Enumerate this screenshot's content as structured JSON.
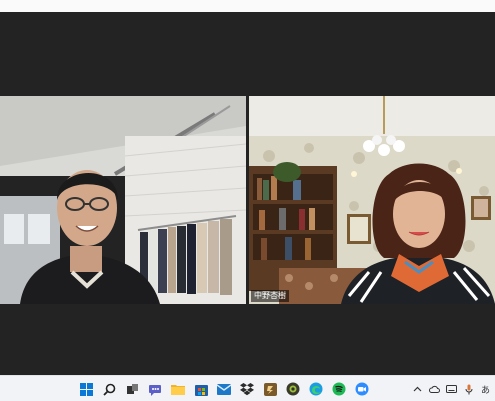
{
  "meeting": {
    "participants": [
      {
        "name": ""
      },
      {
        "name": "中野杏樹"
      }
    ]
  },
  "taskbar": {
    "apps": [
      {
        "icon": "windows-start-icon"
      },
      {
        "icon": "search-icon"
      },
      {
        "icon": "task-view-icon"
      },
      {
        "icon": "teams-chat-icon"
      },
      {
        "icon": "file-explorer-icon"
      },
      {
        "icon": "microsoft-store-icon"
      },
      {
        "icon": "mail-icon"
      },
      {
        "icon": "dropbox-icon"
      },
      {
        "icon": "app-icon"
      },
      {
        "icon": "chrome-style-icon"
      },
      {
        "icon": "edge-icon"
      },
      {
        "icon": "spotify-icon"
      },
      {
        "icon": "zoom-icon"
      }
    ],
    "tray": [
      {
        "icon": "chevron-up-icon"
      },
      {
        "icon": "cloud-icon"
      },
      {
        "icon": "keyboard-icon"
      },
      {
        "icon": "microphone-icon"
      },
      {
        "icon": "language-indicator-icon"
      }
    ],
    "language_indicator": "あ"
  },
  "colors": {
    "meeting_background": "#232323",
    "taskbar_background": "#f1f3f7",
    "windows_blue": "#0a78d4"
  }
}
